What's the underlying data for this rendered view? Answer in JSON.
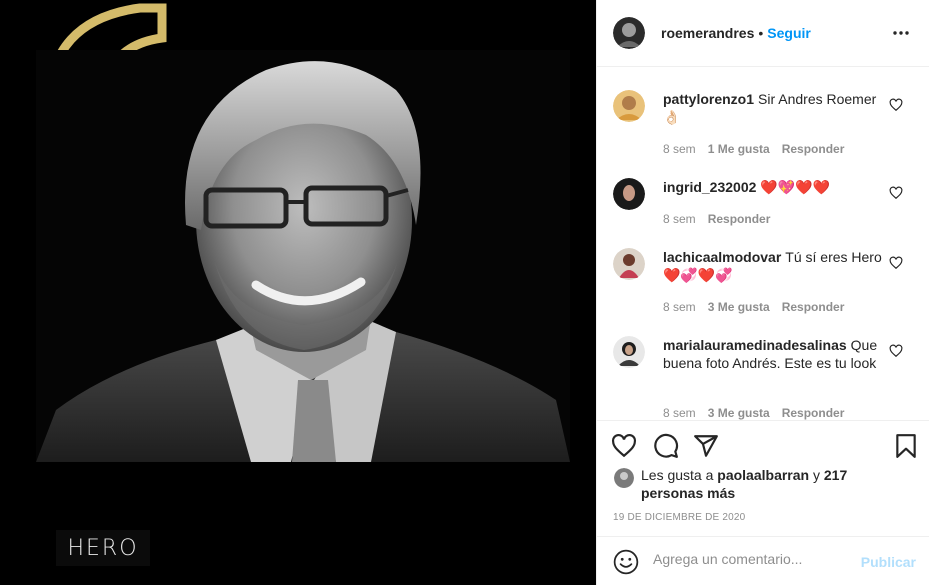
{
  "media": {
    "logo_text": "HERO",
    "accent_color": "#d4bb6a"
  },
  "post": {
    "author": "roemerandres",
    "separator": "•",
    "follow_label": "Seguir"
  },
  "comments": [
    {
      "user": "pattylorenzo1",
      "text": "Sir Andres Roemer 👌🏻",
      "time": "8 sem",
      "likes": "1 Me gusta",
      "reply": "Responder"
    },
    {
      "user": "ingrid_232002",
      "text": "❤️💖❤️❤️",
      "time": "8 sem",
      "likes": "",
      "reply": "Responder"
    },
    {
      "user": "lachicaalmodovar",
      "text": "Tú sí eres Hero ❤️💞❤️💞",
      "time": "8 sem",
      "likes": "3 Me gusta",
      "reply": "Responder"
    },
    {
      "user": "marialauramedinadesalinas",
      "text": "Que buena foto Andrés. Este es tu look",
      "time": "8 sem",
      "likes": "3 Me gusta",
      "reply": "Responder"
    }
  ],
  "likes": {
    "prefix": "Les gusta a",
    "user": "paolaalbarran",
    "conj": "y",
    "others": "217 personas más"
  },
  "date": "19 DE DICIEMBRE DE 2020",
  "add_comment": {
    "placeholder": "Agrega un comentario...",
    "publish_label": "Publicar"
  },
  "icons": {
    "like": "heart-icon",
    "comment": "comment-icon",
    "share": "paper-plane-icon",
    "save": "bookmark-icon",
    "more": "more-options-icon",
    "emoji": "emoji-icon"
  },
  "colors": {
    "link": "#0095f6",
    "muted": "#8e8e8e",
    "publish_disabled": "#b2dffc",
    "heart_red": "#c0152f"
  }
}
